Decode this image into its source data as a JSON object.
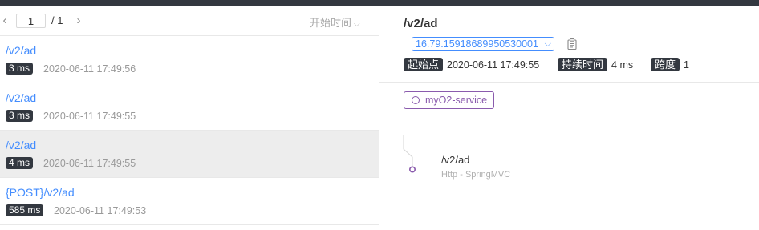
{
  "pager": {
    "prev_icon": "‹",
    "current_page": "1",
    "total": "/ 1",
    "next_icon": "›",
    "sort_label": "开始时间",
    "sort_icon": "chevron-down"
  },
  "traces": [
    {
      "endpoint": "/v2/ad",
      "duration": "3 ms",
      "time": "2020-06-11 17:49:56",
      "active": false
    },
    {
      "endpoint": "/v2/ad",
      "duration": "3 ms",
      "time": "2020-06-11 17:49:55",
      "active": false
    },
    {
      "endpoint": "/v2/ad",
      "duration": "4 ms",
      "time": "2020-06-11 17:49:55",
      "active": true
    },
    {
      "endpoint": "{POST}/v2/ad",
      "duration": "585 ms",
      "time": "2020-06-11 17:49:53",
      "active": false
    }
  ],
  "detail": {
    "title": "/v2/ad",
    "trace_id": "16.79.15918689950530001",
    "start_label": "起始点",
    "start_value": "2020-06-11 17:49:55",
    "duration_label": "持续时间",
    "duration_value": "4 ms",
    "span_label": "跨度",
    "span_value": "1",
    "service": "myO2-service",
    "span_name": "/v2/ad",
    "span_component": "Http - SpringMVC"
  },
  "colors": {
    "link": "#448dfe",
    "badge": "#333840",
    "service": "#8a5bad"
  }
}
